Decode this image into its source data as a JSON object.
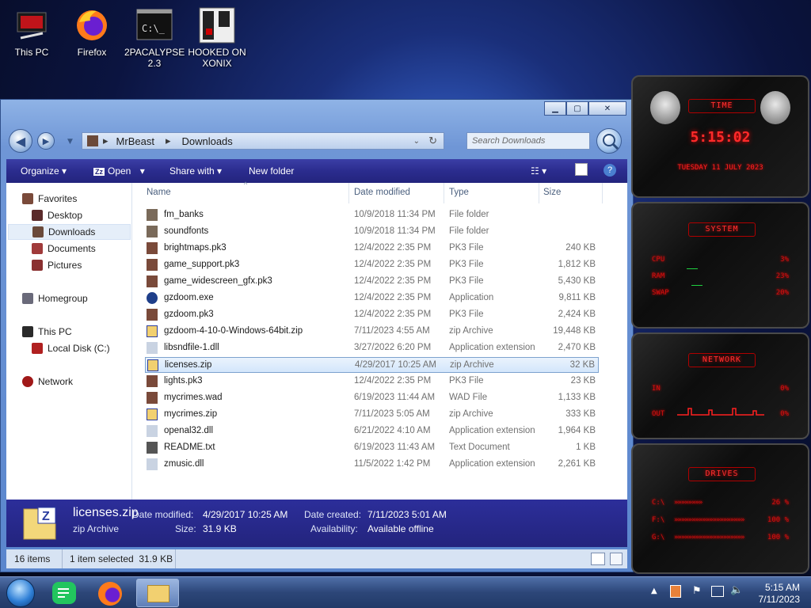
{
  "desktop": {
    "icons": [
      {
        "label": "This PC",
        "icon": "computer-icon"
      },
      {
        "label": "Firefox",
        "icon": "firefox-icon"
      },
      {
        "label": "2PACALYPSE 2.3",
        "icon": "terminal-icon"
      },
      {
        "label": "HOOKED ON XONIX",
        "icon": "game-icon"
      }
    ]
  },
  "explorer": {
    "breadcrumb": [
      "MrBeast",
      "Downloads"
    ],
    "search_placeholder": "Search Downloads",
    "toolbar": {
      "organize": "Organize",
      "open": "Open",
      "share_with": "Share with",
      "new_folder": "New folder"
    },
    "nav": {
      "favorites": "Favorites",
      "desktop": "Desktop",
      "downloads": "Downloads",
      "documents": "Documents",
      "pictures": "Pictures",
      "homegroup": "Homegroup",
      "this_pc": "This PC",
      "local_disk": "Local Disk (C:)",
      "network": "Network"
    },
    "columns": {
      "name": "Name",
      "date": "Date modified",
      "type": "Type",
      "size": "Size"
    },
    "files": [
      {
        "name": "fm_banks",
        "date": "10/9/2018 11:34 PM",
        "type": "File folder",
        "size": "",
        "icon": "folder-icon"
      },
      {
        "name": "soundfonts",
        "date": "10/9/2018 11:34 PM",
        "type": "File folder",
        "size": "",
        "icon": "folder-icon"
      },
      {
        "name": "brightmaps.pk3",
        "date": "12/4/2022 2:35 PM",
        "type": "PK3 File",
        "size": "240 KB",
        "icon": "pk3-file-icon"
      },
      {
        "name": "game_support.pk3",
        "date": "12/4/2022 2:35 PM",
        "type": "PK3 File",
        "size": "1,812 KB",
        "icon": "pk3-file-icon"
      },
      {
        "name": "game_widescreen_gfx.pk3",
        "date": "12/4/2022 2:35 PM",
        "type": "PK3 File",
        "size": "5,430 KB",
        "icon": "pk3-file-icon"
      },
      {
        "name": "gzdoom.exe",
        "date": "12/4/2022 2:35 PM",
        "type": "Application",
        "size": "9,811 KB",
        "icon": "gzdoom-app-icon"
      },
      {
        "name": "gzdoom.pk3",
        "date": "12/4/2022 2:35 PM",
        "type": "PK3 File",
        "size": "2,424 KB",
        "icon": "pk3-file-icon"
      },
      {
        "name": "gzdoom-4-10-0-Windows-64bit.zip",
        "date": "7/11/2023 4:55 AM",
        "type": "zip Archive",
        "size": "19,448 KB",
        "icon": "zip-file-icon"
      },
      {
        "name": "libsndfile-1.dll",
        "date": "3/27/2022 6:20 PM",
        "type": "Application extension",
        "size": "2,470 KB",
        "icon": "dll-file-icon"
      },
      {
        "name": "licenses.zip",
        "date": "4/29/2017 10:25 AM",
        "type": "zip Archive",
        "size": "32 KB",
        "icon": "zip-file-icon"
      },
      {
        "name": "lights.pk3",
        "date": "12/4/2022 2:35 PM",
        "type": "PK3 File",
        "size": "23 KB",
        "icon": "pk3-file-icon"
      },
      {
        "name": "mycrimes.wad",
        "date": "6/19/2023 11:44 AM",
        "type": "WAD File",
        "size": "1,133 KB",
        "icon": "wad-file-icon"
      },
      {
        "name": "mycrimes.zip",
        "date": "7/11/2023 5:05 AM",
        "type": "zip Archive",
        "size": "333 KB",
        "icon": "zip-file-icon"
      },
      {
        "name": "openal32.dll",
        "date": "6/21/2022 4:10 AM",
        "type": "Application extension",
        "size": "1,964 KB",
        "icon": "dll-file-icon"
      },
      {
        "name": "README.txt",
        "date": "6/19/2023 11:43 AM",
        "type": "Text Document",
        "size": "1 KB",
        "icon": "text-file-icon"
      },
      {
        "name": "zmusic.dll",
        "date": "11/5/2022 1:42 PM",
        "type": "Application extension",
        "size": "2,261 KB",
        "icon": "dll-file-icon"
      }
    ],
    "details": {
      "filename": "licenses.zip",
      "filetype": "zip Archive",
      "date_modified_label": "Date modified:",
      "date_modified": "4/29/2017 10:25 AM",
      "size_label": "Size:",
      "size": "31.9 KB",
      "date_created_label": "Date created:",
      "date_created": "7/11/2023 5:01 AM",
      "availability_label": "Availability:",
      "availability": "Available offline"
    },
    "status": {
      "items": "16 items",
      "selected": "1 item selected  31.9 KB"
    }
  },
  "gadgets": {
    "time": {
      "title": "TIME",
      "clock": "5:15:02",
      "date": "TUESDAY 11 JULY 2023"
    },
    "system": {
      "title": "SYSTEM",
      "rows": [
        {
          "label": "CPU",
          "value": "3%"
        },
        {
          "label": "RAM",
          "value": "23%"
        },
        {
          "label": "SWAP",
          "value": "20%"
        }
      ]
    },
    "network": {
      "title": "NETWORK",
      "rows": [
        {
          "label": "IN",
          "value": "0%"
        },
        {
          "label": "OUT",
          "value": "0%"
        }
      ]
    },
    "drives": {
      "title": "DRIVES",
      "rows": [
        {
          "label": "C:\\",
          "value": "26 %"
        },
        {
          "label": "F:\\",
          "value": "100 %"
        },
        {
          "label": "G:\\",
          "value": "100 %"
        }
      ]
    }
  },
  "taskbar": {
    "time": "5:15 AM",
    "date": "7/11/2023"
  }
}
